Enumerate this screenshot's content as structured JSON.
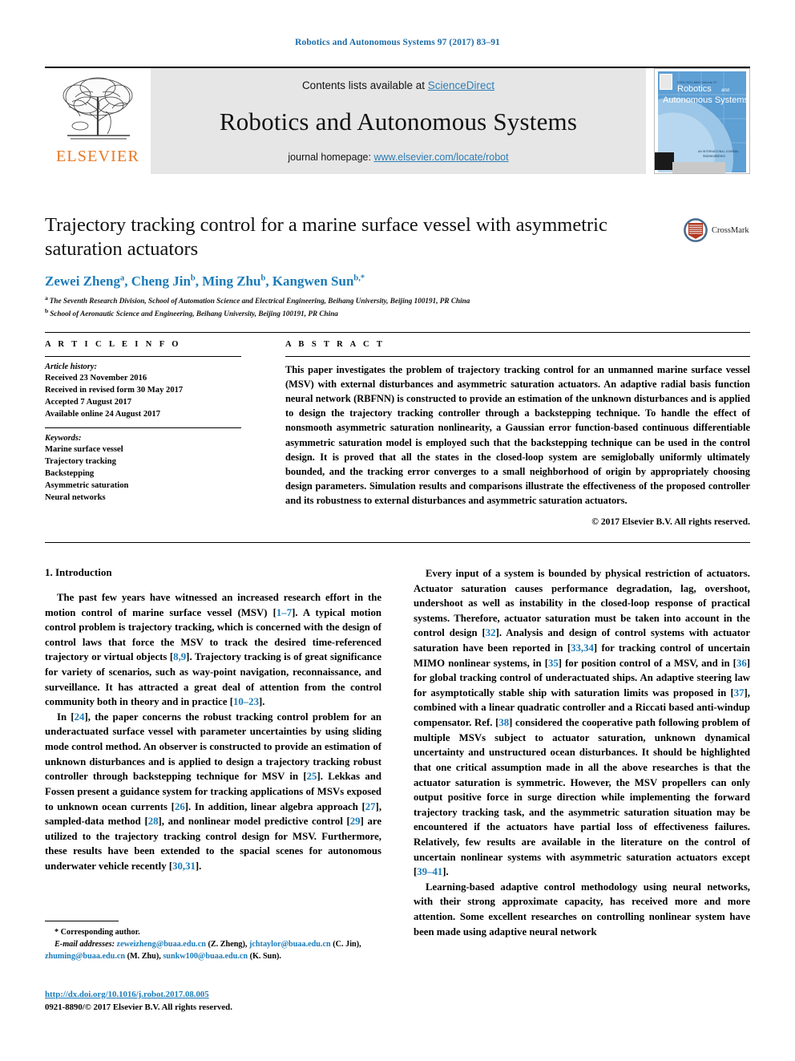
{
  "running_head": "Robotics and Autonomous Systems 97 (2017) 83–91",
  "masthead": {
    "contents_prefix": "Contents lists available at ",
    "sciencedirect": "ScienceDirect",
    "journal_title": "Robotics and Autonomous Systems",
    "homepage_prefix": "journal homepage: ",
    "homepage_url": "www.elsevier.com/locate/robot",
    "publisher": "ELSEVIER",
    "cover_line1": "Robotics",
    "cover_and": "and",
    "cover_line2": "Autonomous Systems",
    "accent_blue": "#2e7db5",
    "elsevier_orange": "#e87722"
  },
  "article": {
    "title": "Trajectory tracking control for a marine surface vessel with asymmetric saturation actuators",
    "authors": [
      {
        "name": "Zewei Zheng",
        "sup": "a",
        "sep": ", "
      },
      {
        "name": "Cheng Jin",
        "sup": "b",
        "sep": ", "
      },
      {
        "name": "Ming Zhu",
        "sup": "b",
        "sep": ", "
      },
      {
        "name": "Kangwen Sun",
        "sup": "b,*",
        "sep": ""
      }
    ],
    "affiliations": [
      {
        "sup": "a",
        "text": "The Seventh Research Division, School of Automation Science and Electrical Engineering, Beihang University, Beijing 100191, PR China"
      },
      {
        "sup": "b",
        "text": "School of Aeronautic Science and Engineering, Beihang University, Beijing 100191, PR China"
      }
    ],
    "crossmark_label": "CrossMark"
  },
  "info": {
    "heading": "A R T I C L E   I N F O",
    "history_label": "Article history:",
    "history": [
      "Received 23 November 2016",
      "Received in revised form 30 May 2017",
      "Accepted 7 August 2017",
      "Available online 24 August 2017"
    ],
    "keywords_label": "Keywords:",
    "keywords": [
      "Marine surface vessel",
      "Trajectory tracking",
      "Backstepping",
      "Asymmetric saturation",
      "Neural networks"
    ]
  },
  "abstract": {
    "heading": "A B S T R A C T",
    "text": "This paper investigates the problem of trajectory tracking control for an unmanned marine surface vessel (MSV) with external disturbances and asymmetric saturation actuators. An adaptive radial basis function neural network (RBFNN) is constructed to provide an estimation of the unknown disturbances and is applied to design the trajectory tracking controller through a backstepping technique. To handle the effect of nonsmooth asymmetric saturation nonlinearity, a Gaussian error function-based continuous differentiable asymmetric saturation model is employed such that the backstepping technique can be used in the control design. It is proved that all the states in the closed-loop system are semiglobally uniformly ultimately bounded, and the tracking error converges to a small neighborhood of origin by appropriately choosing design parameters. Simulation results and comparisons illustrate the effectiveness of the proposed controller and its robustness to external disturbances and asymmetric saturation actuators.",
    "copyright": "© 2017 Elsevier B.V. All rights reserved."
  },
  "body": {
    "section_heading": "1. Introduction",
    "left_paragraphs": [
      "The past few years have witnessed an increased research effort in the motion control of marine surface vessel (MSV) [1–7]. A typical motion control problem is trajectory tracking, which is concerned with the design of control laws that force the MSV to track the desired time-referenced trajectory or virtual objects [8,9]. Trajectory tracking is of great significance for variety of scenarios, such as way-point navigation, reconnaissance, and surveillance. It has attracted a great deal of attention from the control community both in theory and in practice [10–23].",
      "In [24], the paper concerns the robust tracking control problem for an underactuated surface vessel with parameter uncertainties by using sliding mode control method. An observer is constructed to provide an estimation of unknown disturbances and is applied to design a trajectory tracking robust controller through backstepping technique for MSV in [25]. Lekkas and Fossen present a guidance system for tracking applications of MSVs exposed to unknown ocean currents [26]. In addition, linear algebra approach [27], sampled-data method [28], and nonlinear model predictive control [29] are utilized to the trajectory tracking control design for MSV. Furthermore, these results have been extended to the spacial scenes for autonomous underwater vehicle recently [30,31]."
    ],
    "right_paragraphs": [
      "Every input of a system is bounded by physical restriction of actuators. Actuator saturation causes performance degradation, lag, overshoot, undershoot as well as instability in the closed-loop response of practical systems. Therefore, actuator saturation must be taken into account in the control design [32]. Analysis and design of control systems with actuator saturation have been reported in [33,34] for tracking control of uncertain MIMO nonlinear systems, in [35] for position control of a MSV, and in [36] for global tracking control of underactuated ships. An adaptive steering law for asymptotically stable ship with saturation limits was proposed in [37], combined with a linear quadratic controller and a Riccati based anti-windup compensator. Ref. [38] considered the cooperative path following problem of multiple MSVs subject to actuator saturation, unknown dynamical uncertainty and unstructured ocean disturbances. It should be highlighted that one critical assumption made in all the above researches is that the actuator saturation is symmetric. However, the MSV propellers can only output positive force in surge direction while implementing the forward trajectory tracking task, and the asymmetric saturation situation may be encountered if the actuators have partial loss of effectiveness failures. Relatively, few results are available in the literature on the control of uncertain nonlinear systems with asymmetric saturation actuators except [39–41].",
      "Learning-based adaptive control methodology using neural networks, with their strong approximate capacity, has received more and more attention. Some excellent researches on controlling nonlinear system have been made using adaptive neural network"
    ]
  },
  "footnotes": {
    "corresponding": "* Corresponding author.",
    "email_label": "E-mail addresses:",
    "emails": [
      {
        "address": "zeweizheng@buaa.edu.cn",
        "person": "(Z. Zheng)"
      },
      {
        "address": "jchtaylor@buaa.edu.cn",
        "person": "(C. Jin)"
      },
      {
        "address": "zhuming@buaa.edu.cn",
        "person": "(M. Zhu)"
      },
      {
        "address": "sunkw100@buaa.edu.cn",
        "person": "(K. Sun)"
      }
    ],
    "doi": "http://dx.doi.org/10.1016/j.robot.2017.08.005",
    "issn_line": "0921-8890/© 2017 Elsevier B.V. All rights reserved."
  }
}
